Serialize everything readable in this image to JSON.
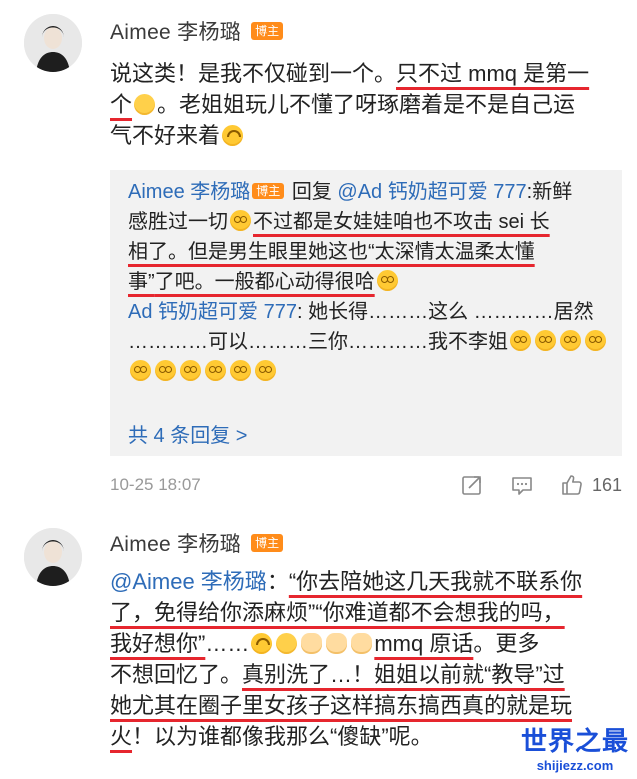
{
  "post1": {
    "username": "Aimee 李杨璐",
    "badge": "博主",
    "content_lines": [
      {
        "segments": [
          {
            "text": "说这类！是我不仅碰到一个。"
          },
          {
            "text": "只不过 mmq 是第一",
            "underline": true
          }
        ]
      },
      {
        "segments": [
          {
            "text": "个",
            "underline": true
          },
          {
            "emoji": "shrug-emoji",
            "underline": true
          },
          {
            "text": "。老姐姐玩儿不懂了呀琢磨着是不是自己运"
          }
        ]
      },
      {
        "segments": [
          {
            "text": "气不好来着"
          },
          {
            "emoji": "upside-down-emoji"
          }
        ]
      }
    ],
    "reply": {
      "lines": [
        {
          "segments": [
            {
              "text": "Aimee 李杨璐",
              "mention": true
            },
            {
              "badge": "博主"
            },
            {
              "text": " 回复 "
            },
            {
              "text": "@Ad 钙奶超可爱 777",
              "mention": true
            },
            {
              "text": ":新鲜"
            }
          ]
        },
        {
          "segments": [
            {
              "text": "感胜过一切"
            },
            {
              "emoji": "dizzy-emoji"
            },
            {
              "text": "不过都是女娃娃咱也不攻击 sei 长",
              "underline": true
            }
          ]
        },
        {
          "segments": [
            {
              "text": "相了。",
              "underline": true
            },
            {
              "text": "但是男生眼里她这也“太深情太温柔太懂",
              "underline": true
            }
          ]
        },
        {
          "segments": [
            {
              "text": "事”",
              "underline": true
            },
            {
              "text": "了吧。一般都心动得很哈",
              "underline": true
            },
            {
              "emoji": "dizzy-emoji"
            }
          ]
        },
        {
          "segments": [
            {
              "text": "Ad 钙奶超可爱 777",
              "mention": true
            },
            {
              "text": ": 她长得………这么 …………居然"
            }
          ]
        },
        {
          "segments": [
            {
              "text": "…………可以………三你…………我不李姐"
            },
            {
              "emoji": "dizzy-emoji"
            },
            {
              "emoji": "dizzy-emoji"
            },
            {
              "emoji": "dizzy-emoji"
            },
            {
              "emoji": "dizzy-emoji"
            }
          ]
        },
        {
          "segments": [
            {
              "emoji": "dizzy-emoji"
            },
            {
              "emoji": "dizzy-emoji"
            },
            {
              "emoji": "dizzy-emoji"
            },
            {
              "emoji": "dizzy-emoji"
            },
            {
              "emoji": "dizzy-emoji"
            },
            {
              "emoji": "dizzy-emoji"
            }
          ]
        }
      ],
      "more_replies": "共 4 条回复 >"
    },
    "timestamp": "10-25 18:07",
    "like_count": "161"
  },
  "post2": {
    "username": "Aimee 李杨璐",
    "badge": "博主",
    "content_lines": [
      {
        "segments": [
          {
            "text": "@Aimee 李杨璐",
            "mention": true
          },
          {
            "text": "："
          },
          {
            "text": "“你去陪她这几天我就不联系你",
            "underline": true
          }
        ]
      },
      {
        "segments": [
          {
            "text": "了，免得给你添麻烦”“你难道都不会想我的吗，",
            "underline": true
          }
        ]
      },
      {
        "segments": [
          {
            "text": "我好想你”",
            "underline": true
          },
          {
            "text": "……"
          },
          {
            "emoji": "upside-down-emoji"
          },
          {
            "emoji": "shrug-emoji"
          },
          {
            "emoji": "clap-emoji"
          },
          {
            "emoji": "clap-emoji"
          },
          {
            "emoji": "clap-emoji"
          },
          {
            "text": "mmq 原话",
            "underline": true
          },
          {
            "text": "。更多"
          }
        ]
      },
      {
        "segments": [
          {
            "text": "不想回忆了。"
          },
          {
            "text": "真别洗了…！",
            "underline": true
          },
          {
            "text": "姐姐以前就“教导”过",
            "underline": true
          }
        ]
      },
      {
        "segments": [
          {
            "text": "她尤其在圈子里女孩子这样搞东搞西真的就是玩",
            "underline": true
          }
        ]
      },
      {
        "segments": [
          {
            "text": "火",
            "underline": true
          },
          {
            "text": "！以为谁都像我那么“傻缺”呢。"
          }
        ]
      }
    ]
  },
  "watermark": {
    "cn": "世界之最",
    "url": "shijiezz.com"
  },
  "colors": {
    "mention": "#2e6cb8",
    "underline": "#e6262e",
    "badge": "#ff8c1a",
    "reply_bg": "#f2f2f2"
  }
}
